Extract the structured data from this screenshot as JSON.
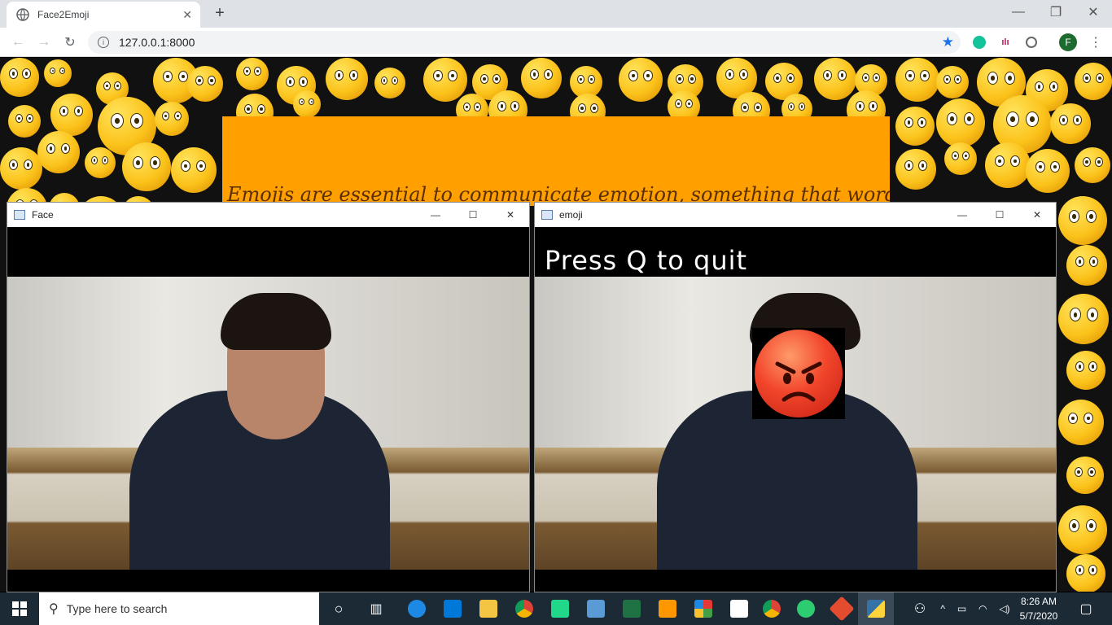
{
  "browser": {
    "tab_title": "Face2Emoji",
    "url": "127.0.0.1:8000",
    "profile_initial": "F"
  },
  "page": {
    "banner_text": "Emojis are essential to communicate emotion, something that words cannot portray"
  },
  "windows": [
    {
      "title": "Face"
    },
    {
      "title": "emoji",
      "overlay_text": "Press Q to quit"
    }
  ],
  "taskbar": {
    "search_placeholder": "Type here to search",
    "time": "8:26 AM",
    "date": "5/7/2020"
  }
}
